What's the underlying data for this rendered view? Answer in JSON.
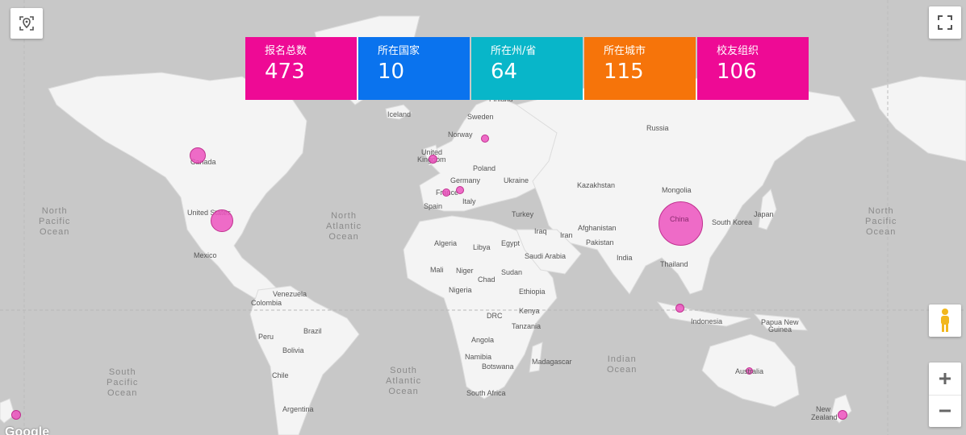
{
  "stats": [
    {
      "label": "报名总数",
      "value": "473",
      "color": "#ee0a95"
    },
    {
      "label": "所在国家",
      "value": "10",
      "color": "#0a73ee"
    },
    {
      "label": "所在州/省",
      "value": "64",
      "color": "#08b6c9"
    },
    {
      "label": "所在城市",
      "value": "115",
      "color": "#f6740a"
    },
    {
      "label": "校友组织",
      "value": "106",
      "color": "#ee0a95"
    }
  ],
  "countries": {
    "canada": "Canada",
    "us": "United States",
    "mexico": "Mexico",
    "venezuela": "Venezuela",
    "colombia": "Colombia",
    "peru": "Peru",
    "brazil": "Brazil",
    "bolivia": "Bolivia",
    "chile": "Chile",
    "argentina": "Argentina",
    "iceland": "Iceland",
    "norway": "Norway",
    "sweden": "Sweden",
    "finland": "Finland",
    "uk1": "United",
    "uk2": "Kingdom",
    "poland": "Poland",
    "germany": "Germany",
    "france": "France",
    "italy": "Italy",
    "spain": "Spain",
    "ukraine": "Ukraine",
    "turkey": "Turkey",
    "russia": "Russia",
    "kazakhstan": "Kazakhstan",
    "mongolia": "Mongolia",
    "china": "China",
    "south_korea": "South Korea",
    "japan": "Japan",
    "afghanistan": "Afghanistan",
    "iraq": "Iraq",
    "iran": "Iran",
    "pakistan": "Pakistan",
    "india": "India",
    "thailand": "Thailand",
    "algeria": "Algeria",
    "libya": "Libya",
    "egypt": "Egypt",
    "saudi": "Saudi Arabia",
    "mali": "Mali",
    "niger": "Niger",
    "chad": "Chad",
    "sudan": "Sudan",
    "nigeria": "Nigeria",
    "ethiopia": "Ethiopia",
    "kenya": "Kenya",
    "drc": "DRC",
    "tanzania": "Tanzania",
    "angola": "Angola",
    "namibia": "Namibia",
    "botswana": "Botswana",
    "madagascar": "Madagascar",
    "south_africa": "South Africa",
    "indonesia": "Indonesia",
    "png1": "Papua New",
    "png2": "Guinea",
    "australia": "Australia",
    "nz1": "New",
    "nz2": "Zealand"
  },
  "oceans": {
    "north_pacific_left": "North\nPacific\nOcean",
    "north_pacific_right": "North\nPacific\nOcean",
    "north_atlantic": "North\nAtlantic\nOcean",
    "south_pacific": "South\nPacific\nOcean",
    "south_atlantic": "South\nAtlantic\nOcean",
    "indian": "Indian\nOcean"
  },
  "attribution": "Google",
  "colors": {
    "marker": "#ec52be",
    "land": "#f4f4f4",
    "water": "#c8c8c8"
  }
}
